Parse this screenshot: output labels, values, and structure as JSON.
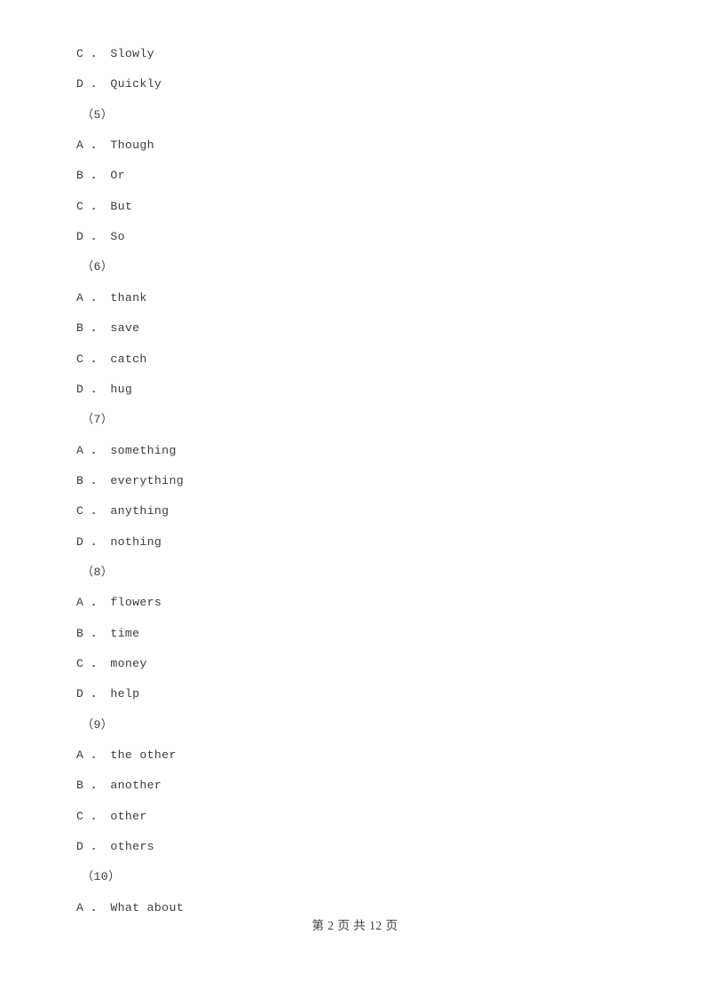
{
  "document": {
    "page_background": "#ffffff",
    "text_color": "#3c3c3c"
  },
  "lines": [
    {
      "kind": "option",
      "letter": "C",
      "sep": "． ",
      "text": "Slowly",
      "label": "C ． Slowly"
    },
    {
      "kind": "option",
      "letter": "D",
      "sep": "． ",
      "text": "Quickly",
      "label": "D ． Quickly"
    },
    {
      "kind": "question",
      "number": "（5）",
      "label": "（5）"
    },
    {
      "kind": "option",
      "letter": "A",
      "sep": "． ",
      "text": "Though",
      "label": "A ． Though"
    },
    {
      "kind": "option",
      "letter": "B",
      "sep": "． ",
      "text": "Or",
      "label": "B ． Or"
    },
    {
      "kind": "option",
      "letter": "C",
      "sep": "． ",
      "text": "But",
      "label": "C ． But"
    },
    {
      "kind": "option",
      "letter": "D",
      "sep": "． ",
      "text": "So",
      "label": "D ． So"
    },
    {
      "kind": "question",
      "number": "（6）",
      "label": "（6）"
    },
    {
      "kind": "option",
      "letter": "A",
      "sep": "． ",
      "text": "thank",
      "label": "A ． thank"
    },
    {
      "kind": "option",
      "letter": "B",
      "sep": "． ",
      "text": "save",
      "label": "B ． save"
    },
    {
      "kind": "option",
      "letter": "C",
      "sep": "． ",
      "text": "catch",
      "label": "C ． catch"
    },
    {
      "kind": "option",
      "letter": "D",
      "sep": "． ",
      "text": "hug",
      "label": "D ． hug"
    },
    {
      "kind": "question",
      "number": "（7）",
      "label": "（7）"
    },
    {
      "kind": "option",
      "letter": "A",
      "sep": "． ",
      "text": "something",
      "label": "A ． something"
    },
    {
      "kind": "option",
      "letter": "B",
      "sep": "． ",
      "text": "everything",
      "label": "B ． everything"
    },
    {
      "kind": "option",
      "letter": "C",
      "sep": "． ",
      "text": "anything",
      "label": "C ． anything"
    },
    {
      "kind": "option",
      "letter": "D",
      "sep": "． ",
      "text": "nothing",
      "label": "D ． nothing"
    },
    {
      "kind": "question",
      "number": "（8）",
      "label": "（8）"
    },
    {
      "kind": "option",
      "letter": "A",
      "sep": "． ",
      "text": "flowers",
      "label": "A ． flowers"
    },
    {
      "kind": "option",
      "letter": "B",
      "sep": "． ",
      "text": "time",
      "label": "B ． time"
    },
    {
      "kind": "option",
      "letter": "C",
      "sep": "． ",
      "text": "money",
      "label": "C ． money"
    },
    {
      "kind": "option",
      "letter": "D",
      "sep": "． ",
      "text": "help",
      "label": "D ． help"
    },
    {
      "kind": "question",
      "number": "（9）",
      "label": "（9）"
    },
    {
      "kind": "option",
      "letter": "A",
      "sep": "． ",
      "text": "the other",
      "label": "A ． the other"
    },
    {
      "kind": "option",
      "letter": "B",
      "sep": "． ",
      "text": "another",
      "label": "B ． another"
    },
    {
      "kind": "option",
      "letter": "C",
      "sep": "． ",
      "text": "other",
      "label": "C ． other"
    },
    {
      "kind": "option",
      "letter": "D",
      "sep": "． ",
      "text": "others",
      "label": "D ． others"
    },
    {
      "kind": "question",
      "number": "（10）",
      "label": "（10）"
    },
    {
      "kind": "option",
      "letter": "A",
      "sep": "． ",
      "text": "What about",
      "label": "A ． What about"
    }
  ],
  "footer": {
    "text": "第 2 页 共 12 页",
    "current_page": "2",
    "total_pages": "12"
  }
}
